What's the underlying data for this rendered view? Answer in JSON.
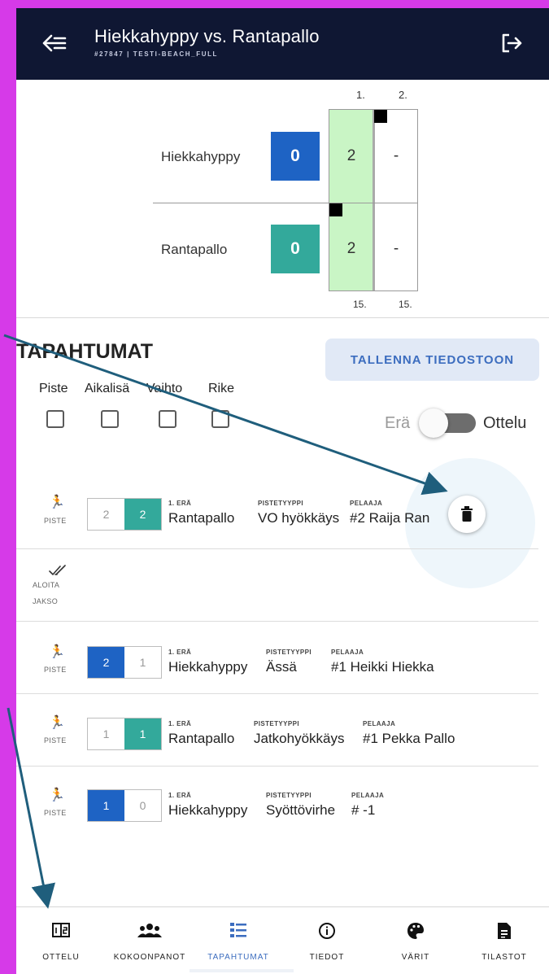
{
  "header": {
    "title": "Hiekkahyppy vs. Rantapallo",
    "subtitle": "#27847 | TESTI-BEACH_FULL"
  },
  "scoreboard": {
    "set_headers": [
      "1.",
      "2."
    ],
    "footer": [
      "15.",
      "15."
    ],
    "teams": [
      {
        "name": "Hiekkahyppy",
        "total": "0",
        "total_color": "#1e63c4",
        "sets": [
          "2",
          "-"
        ]
      },
      {
        "name": "Rantapallo",
        "total": "0",
        "total_color": "#33a99b",
        "sets": [
          "2",
          "-"
        ]
      }
    ],
    "active_set_color": "#c9f5c5"
  },
  "events": {
    "title": "TAPAHTUMAT",
    "save_button": "TALLENNA TIEDOSTOON",
    "filters": [
      "Piste",
      "Aikalisä",
      "Vaihto",
      "Rike"
    ],
    "toggle_left": "Erä",
    "toggle_right": "Ottelu",
    "list": [
      {
        "type": "PISTE",
        "home": "2",
        "away": "2",
        "highlight": "away",
        "set_label": "1. ERÄ",
        "team": "Rantapallo",
        "points_label": "PISTETYYPPI",
        "point_type": "VO hyökkäys",
        "player_label": "PELAAJA",
        "player": "#2 Raija Ran"
      },
      {
        "type_lines": [
          "ALOITA",
          "JAKSO"
        ]
      },
      {
        "type": "PISTE",
        "home": "2",
        "away": "1",
        "highlight": "home",
        "set_label": "1. ERÄ",
        "team": "Hiekkahyppy",
        "points_label": "PISTETYYPPI",
        "point_type": "Ässä",
        "player_label": "PELAAJA",
        "player": "#1 Heikki Hiekka"
      },
      {
        "type": "PISTE",
        "home": "1",
        "away": "1",
        "highlight": "away",
        "set_label": "1. ERÄ",
        "team": "Rantapallo",
        "points_label": "PISTETYYPPI",
        "point_type": "Jatkohyökkäys",
        "player_label": "PELAAJA",
        "player": "#1 Pekka Pallo"
      },
      {
        "type": "PISTE",
        "home": "1",
        "away": "0",
        "highlight": "home",
        "set_label": "1. ERÄ",
        "team": "Hiekkahyppy",
        "points_label": "PISTETYYPPI",
        "point_type": "Syöttövirhe",
        "player_label": "PELAAJA",
        "player": "# -1"
      }
    ]
  },
  "nav": [
    {
      "label": "OTTELU",
      "icon": "scoreboard-icon"
    },
    {
      "label": "KOKOONPANOT",
      "icon": "people-icon"
    },
    {
      "label": "TAPAHTUMAT",
      "icon": "list-icon",
      "active": true
    },
    {
      "label": "TIEDOT",
      "icon": "info-icon"
    },
    {
      "label": "VÄRIT",
      "icon": "palette-icon"
    },
    {
      "label": "TILASTOT",
      "icon": "document-icon"
    }
  ],
  "colors": {
    "header_bg": "#0f1733",
    "accent_blue": "#1e63c4",
    "accent_teal": "#33a99b",
    "annotation_arrow": "#1f5e7c",
    "frame_bg": "#d63ae8"
  }
}
